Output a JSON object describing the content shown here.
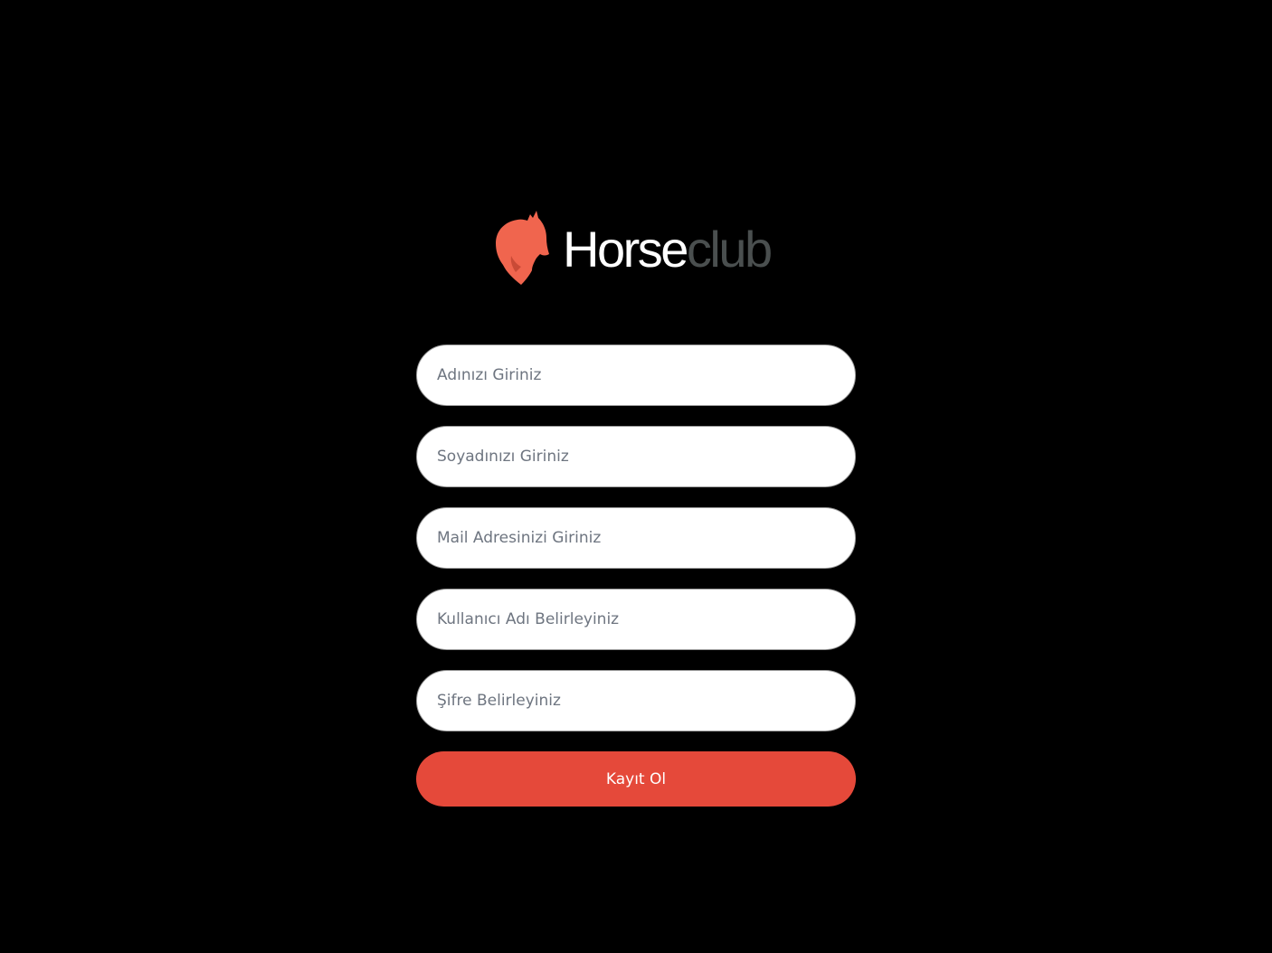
{
  "brand": {
    "name_part1": "Horse",
    "name_part2": "club",
    "icon": "horse-head-icon",
    "accent_color": "#f0654e"
  },
  "form": {
    "fields": [
      {
        "placeholder": "Adınızı Giriniz",
        "value": ""
      },
      {
        "placeholder": "Soyadınızı Giriniz",
        "value": ""
      },
      {
        "placeholder": "Mail Adresinizi Giriniz",
        "value": ""
      },
      {
        "placeholder": "Kullanıcı Adı Belirleyiniz",
        "value": ""
      },
      {
        "placeholder": "Şifre Belirleyiniz",
        "value": ""
      }
    ],
    "submit_label": "Kayıt Ol",
    "submit_color": "#e5493a"
  }
}
